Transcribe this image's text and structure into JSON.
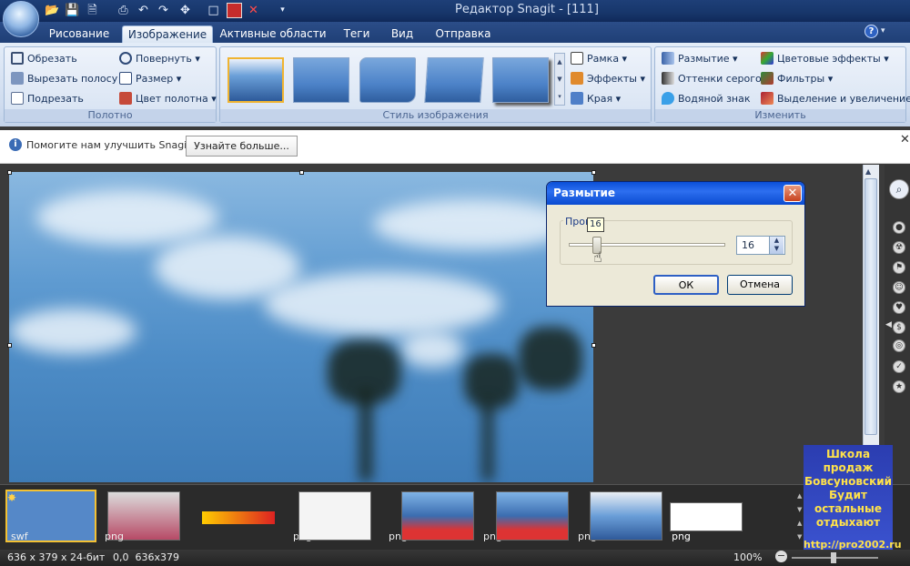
{
  "window": {
    "title": "Редактор Snagit - [111]"
  },
  "tabs": [
    "Рисование",
    "Изображение",
    "Активные области",
    "Теги",
    "Вид",
    "Отправка"
  ],
  "active_tab": "Изображение",
  "ribbon": {
    "canvas_group": {
      "label": "Полотно",
      "buttons": [
        "Обрезать",
        "Вырезать полосу",
        "Подрезать",
        "Повернуть",
        "Размер",
        "Цвет полотна"
      ]
    },
    "style_group": {
      "label": "Стиль изображения",
      "buttons": [
        "Рамка",
        "Эффекты",
        "Края"
      ]
    },
    "modify_group": {
      "label": "Изменить",
      "buttons": [
        "Размытие",
        "Оттенки серого",
        "Водяной знак",
        "Цветовые эффекты",
        "Фильтры",
        "Выделение и увеличение"
      ]
    }
  },
  "infobar": {
    "text": "Помогите нам улучшить Snagit",
    "button": "Узнайте больше..."
  },
  "dialog": {
    "title": "Размытие",
    "legend": "Проц",
    "tooltip": "16",
    "value": "16",
    "slider_level_percent": 16,
    "ok": "ОК",
    "cancel": "Отмена"
  },
  "tray": {
    "items": [
      {
        "type": "swf"
      },
      {
        "type": "png"
      },
      {
        "type": "png"
      },
      {
        "type": "png"
      },
      {
        "type": "png"
      },
      {
        "type": "png"
      },
      {
        "type": "png"
      },
      {
        "type": "png"
      }
    ]
  },
  "promo": {
    "lines": [
      "Школа продаж",
      "Бовсуновский",
      "Будит",
      "остальные",
      "отдыхают"
    ],
    "url": "http://pro2002.ru"
  },
  "status": {
    "dimensions": "636 x 379 x 24-бит",
    "coords": "0,0  636x379",
    "zoom": "100%"
  }
}
